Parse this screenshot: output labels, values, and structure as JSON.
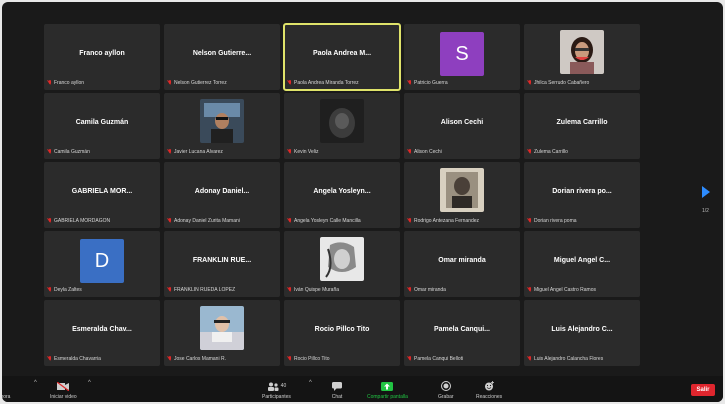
{
  "tiles": [
    {
      "name": "Franco ayllon",
      "label": "Franco ayllon",
      "type": "name"
    },
    {
      "name": "Nelson Gutierre...",
      "label": "Nelson Gutierrez Torrez",
      "type": "name"
    },
    {
      "name": "Paola Andrea M...",
      "label": "Paola Andrea Miranda Torrez",
      "type": "name",
      "active": true
    },
    {
      "name": "S",
      "label": "Patricio Guerra",
      "type": "letter",
      "color": "#8e3fbf"
    },
    {
      "name": "",
      "label": "Jhilca Serrudo Cabañero",
      "type": "photo",
      "photo": "woman-photo"
    },
    {
      "name": "Camila Guzmán",
      "label": "Camila Guzmán",
      "type": "name"
    },
    {
      "name": "",
      "label": "Javier Lucana Alvarez",
      "type": "photo",
      "photo": "man-photo"
    },
    {
      "name": "",
      "label": "Kevin Veliz",
      "type": "photo",
      "photo": "dark-photo"
    },
    {
      "name": "Alison Cechi",
      "label": "Alison Cechi",
      "type": "name"
    },
    {
      "name": "Zulema Carrillo",
      "label": "Zulema Carrillo",
      "type": "name"
    },
    {
      "name": "GABRIELA MOR...",
      "label": "GABRIELA MORDAGON",
      "type": "name"
    },
    {
      "name": "Adonay Daniel...",
      "label": "Adonay Daniel Zurita Mamani",
      "type": "name"
    },
    {
      "name": "Angela Yosleyn...",
      "label": "Angela Yosleyn Calle Mancilla",
      "type": "name"
    },
    {
      "name": "",
      "label": "Rodrigo Antezana Fernandez",
      "type": "photo",
      "photo": "art-photo"
    },
    {
      "name": "Dorian rivera po...",
      "label": "Dorian rivera poma",
      "type": "name"
    },
    {
      "name": "D",
      "label": "Deyla Zaltes",
      "type": "letter",
      "color": "#3a6fc4"
    },
    {
      "name": "FRANKLIN RUE...",
      "label": "FRANKLIN RUEDA LOPEZ",
      "type": "name"
    },
    {
      "name": "",
      "label": "Iván Quispe Muraña",
      "type": "photo",
      "photo": "sketch-photo"
    },
    {
      "name": "Omar miranda",
      "label": "Omar miranda",
      "type": "name"
    },
    {
      "name": "Miguel Angel C...",
      "label": "Miguel Angel Castro Ramos",
      "type": "name"
    },
    {
      "name": "Esmeralda Chav...",
      "label": "Esmeralda Chavarria",
      "type": "name"
    },
    {
      "name": "",
      "label": "Jose Carlos Mamani R.",
      "type": "photo",
      "photo": "car-photo"
    },
    {
      "name": "Rocio Pillco Tito",
      "label": "Rocio Pillco Tito",
      "type": "name"
    },
    {
      "name": "Pamela Canqui...",
      "label": "Pamela Canqui Belloti",
      "type": "name"
    },
    {
      "name": "Luis Alejandro C...",
      "label": "Luis Alejandro Calancha Flores",
      "type": "name"
    }
  ],
  "pager": {
    "indicator": "1/2"
  },
  "toolbar": {
    "unmute_label": "rabora",
    "video_label": "Iniciar video",
    "participants_label": "Participantes",
    "participants_count": "40",
    "chat_label": "Chat",
    "share_label": "Compartir pantalla",
    "record_label": "Grabar",
    "reactions_label": "Reacciones",
    "leave_label": "Salir"
  },
  "colors": {
    "active_border": "#dfe36a",
    "share_green": "#21c443",
    "leave_red": "#e0262e",
    "pager_blue": "#2d8cff"
  }
}
